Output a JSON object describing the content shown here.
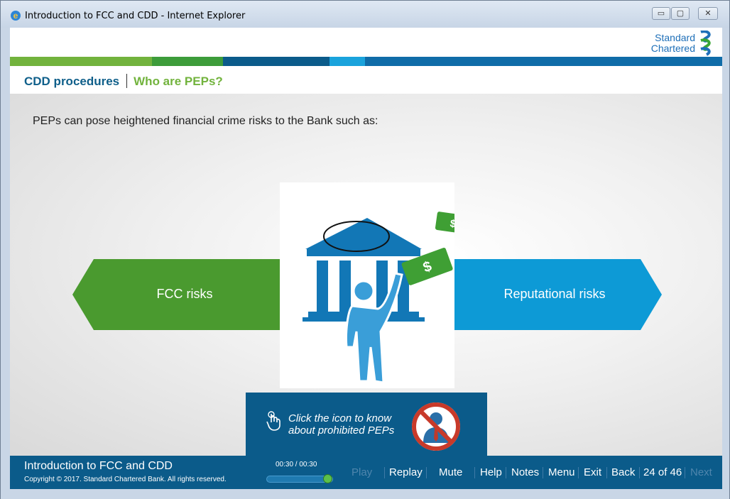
{
  "window": {
    "title": "Introduction to FCC and CDD - Internet Explorer",
    "minimize_label": "▭",
    "maximize_label": "▢",
    "close_label": "✕"
  },
  "brand": {
    "line1": "Standard",
    "line2": "Chartered"
  },
  "colors": {
    "green": "#72b33d",
    "dark_green": "#4a9a2f",
    "blue": "#0d9ad6",
    "navy": "#0b5b8a"
  },
  "breadcrumb": {
    "section": "CDD procedures",
    "topic": "Who are PEPs?"
  },
  "slide": {
    "intro": "PEPs can pose heightened financial crime risks to the Bank such as:",
    "left_label": "FCC risks",
    "right_label": "Reputational risks",
    "center_icon": "bank-with-person-holding-cash-icon",
    "prompt_line1": "Click the icon to know",
    "prompt_line2": "about prohibited PEPs",
    "prompt_icon": "prohibited-person-icon"
  },
  "footer": {
    "course_title": "Introduction to FCC and CDD",
    "copyright": "Copyright © 2017. Standard Chartered Bank. All rights reserved.",
    "time": "00:30 / 00:30",
    "progress": 1.0,
    "buttons": {
      "play": "Play",
      "replay": "Replay",
      "mute": "Mute",
      "help": "Help",
      "notes": "Notes",
      "menu": "Menu",
      "exit": "Exit",
      "back": "Back",
      "next": "Next"
    },
    "page_counter": "24 of 46"
  }
}
